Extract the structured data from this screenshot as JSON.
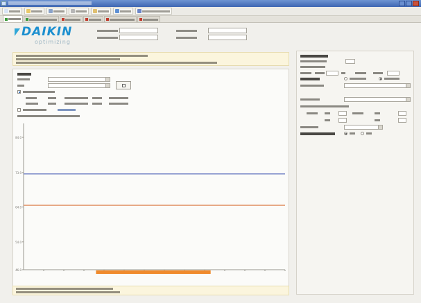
{
  "window": {
    "title": ""
  },
  "toolbar": {
    "buttons": [
      {
        "icon": "new-icon",
        "color": "#d9e4f5"
      },
      {
        "icon": "open-icon",
        "color": "#e9c96a"
      },
      {
        "icon": "save-icon",
        "color": "#8aa3c9"
      },
      {
        "icon": "print-icon",
        "color": "#b7b7b7"
      },
      {
        "icon": "preferences-icon",
        "color": "#e0c070"
      },
      {
        "icon": "help-icon",
        "color": "#5d8fd3"
      },
      {
        "icon": "database-icon",
        "color": "#6b86c9"
      }
    ]
  },
  "tabs": [
    {
      "status": "ok",
      "color": "#3a9a3a",
      "active": true
    },
    {
      "status": "ok",
      "color": "#3a9a3a",
      "active": false
    },
    {
      "status": "error",
      "color": "#c0392b",
      "active": false
    },
    {
      "status": "error",
      "color": "#c0392b",
      "active": false
    },
    {
      "status": "error",
      "color": "#c0392b",
      "active": false
    },
    {
      "status": "error",
      "color": "#c0392b",
      "active": false
    }
  ],
  "header": {
    "logo_text": "DAIKIN",
    "logo_sub": "optimizing",
    "logo_color": "#1c8fcf"
  },
  "chart_data": {
    "type": "line",
    "series": [
      {
        "values": [
          73.5,
          73.5
        ],
        "color": "#6f7fc4"
      },
      {
        "values": [
          64.5,
          64.5
        ],
        "color": "#e08a5c"
      }
    ],
    "ylim": [
      46,
      88
    ],
    "yticks": [
      84.0,
      73.9,
      64.0,
      54.0,
      46.0
    ],
    "categories": [
      "",
      "",
      "",
      "",
      "",
      "",
      "",
      "",
      "",
      "",
      "",
      "",
      ""
    ],
    "highlight": {
      "from": 3.6,
      "to": 9.3,
      "color": "#f08a2c"
    }
  },
  "right_panel": {
    "radio_selected": [
      false,
      true,
      true,
      false
    ]
  }
}
